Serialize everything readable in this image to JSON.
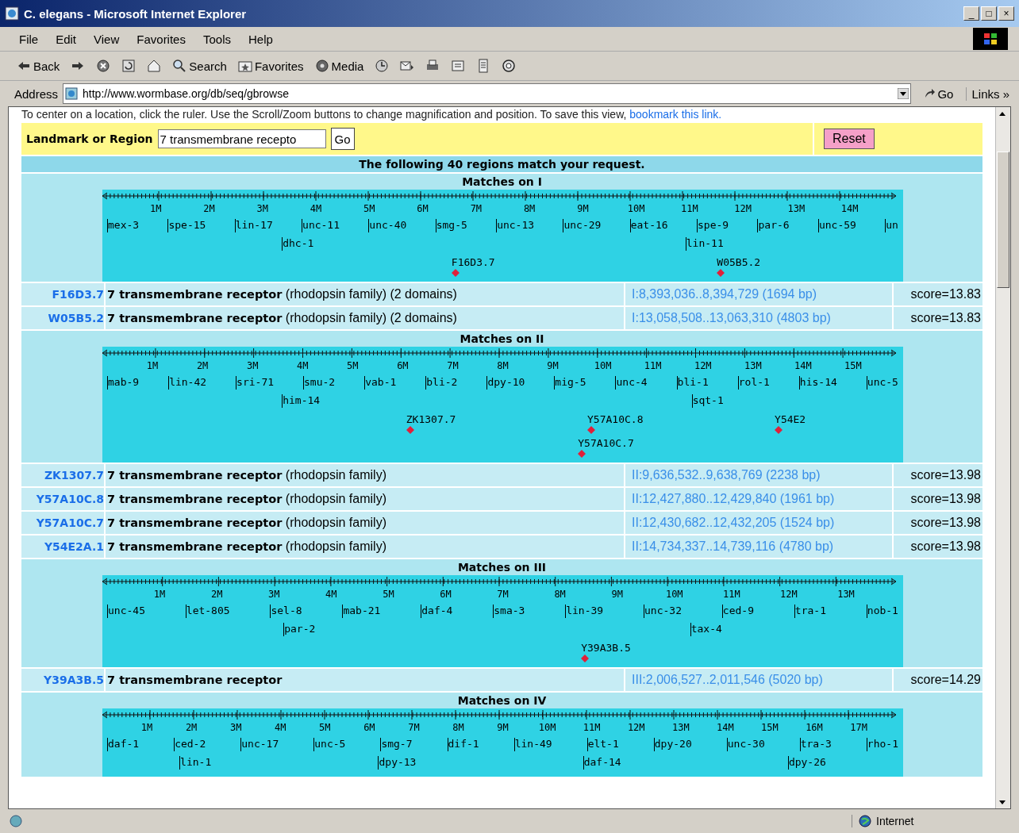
{
  "window": {
    "title": "C. elegans - Microsoft Internet Explorer",
    "controls": [
      "_",
      "□",
      "×"
    ]
  },
  "menu": [
    "File",
    "Edit",
    "View",
    "Favorites",
    "Tools",
    "Help"
  ],
  "toolbar": [
    {
      "kind": "back",
      "label": "Back"
    },
    {
      "kind": "forward"
    },
    {
      "kind": "stop"
    },
    {
      "kind": "refresh"
    },
    {
      "kind": "home"
    },
    {
      "kind": "search",
      "label": "Search"
    },
    {
      "kind": "favorites",
      "label": "Favorites"
    },
    {
      "kind": "media",
      "label": "Media"
    },
    {
      "kind": "history"
    },
    {
      "kind": "mail"
    },
    {
      "kind": "print"
    },
    {
      "kind": "edit"
    },
    {
      "kind": "discuss"
    },
    {
      "kind": "messenger"
    }
  ],
  "address": {
    "label": "Address",
    "value": "http://www.wormbase.org/db/seq/gbrowse",
    "go": "Go",
    "links": "Links »"
  },
  "page": {
    "instructions": "To center on a location, click the ruler. Use the Scroll/Zoom buttons to change magnification and position. To save this view,",
    "bookmark_link": "bookmark this link.",
    "landmark": {
      "label": "Landmark or Region",
      "value": "7 transmembrane recepto",
      "go": "Go",
      "reset": "Reset"
    },
    "banner": "The following 40 regions match your request.",
    "sections": [
      {
        "title": "Matches on I",
        "ticks": [
          "1M",
          "2M",
          "3M",
          "4M",
          "5M",
          "6M",
          "7M",
          "8M",
          "9M",
          "10M",
          "11M",
          "12M",
          "13M",
          "14M"
        ],
        "gene_rows": [
          [
            "mex-3",
            "spe-15",
            "lin-17",
            "unc-11",
            "unc-40",
            "smg-5",
            "unc-13",
            "unc-29",
            "eat-16",
            "spe-9",
            "par-6",
            "unc-59",
            "un"
          ],
          [
            "dhc-1",
            "lin-11"
          ]
        ],
        "hit_rows": [
          [
            "F16D3.7",
            "W05B5.2"
          ]
        ],
        "matches": [
          {
            "id": "F16D3.7",
            "description": "**7 transmembrane receptor** (rhodopsin family) (2 domains)",
            "location": "I:8,393,036..8,394,729 (1694 bp)",
            "score": "score=13.83"
          },
          {
            "id": "W05B5.2",
            "description": "**7 transmembrane receptor** (rhodopsin family) (2 domains)",
            "location": "I:13,058,508..13,063,310 (4803 bp)",
            "score": "score=13.83"
          }
        ]
      },
      {
        "title": "Matches on II",
        "ticks": [
          "1M",
          "2M",
          "3M",
          "4M",
          "5M",
          "6M",
          "7M",
          "8M",
          "9M",
          "10M",
          "11M",
          "12M",
          "13M",
          "14M",
          "15M"
        ],
        "gene_rows": [
          [
            "mab-9",
            "lin-42",
            "sri-71",
            "smu-2",
            "vab-1",
            "bli-2",
            "dpy-10",
            "mig-5",
            "unc-4",
            "bli-1",
            "rol-1",
            "his-14",
            "unc-5"
          ],
          [
            "him-14",
            "sqt-1"
          ]
        ],
        "hit_rows": [
          [
            "ZK1307.7",
            "Y57A10C.8",
            "Y54E2"
          ],
          [
            "Y57A10C.7"
          ]
        ],
        "matches": [
          {
            "id": "ZK1307.7",
            "description": "**7 transmembrane receptor** (rhodopsin family)",
            "location": "II:9,636,532..9,638,769 (2238 bp)",
            "score": "score=13.98"
          },
          {
            "id": "Y57A10C.8",
            "description": "**7 transmembrane receptor** (rhodopsin family)",
            "location": "II:12,427,880..12,429,840 (1961 bp)",
            "score": "score=13.98"
          },
          {
            "id": "Y57A10C.7",
            "description": "**7 transmembrane receptor** (rhodopsin family)",
            "location": "II:12,430,682..12,432,205 (1524 bp)",
            "score": "score=13.98"
          },
          {
            "id": "Y54E2A.1",
            "description": "**7 transmembrane receptor** (rhodopsin family)",
            "location": "II:14,734,337..14,739,116 (4780 bp)",
            "score": "score=13.98"
          }
        ]
      },
      {
        "title": "Matches on III",
        "ticks": [
          "1M",
          "2M",
          "3M",
          "4M",
          "5M",
          "6M",
          "7M",
          "8M",
          "9M",
          "10M",
          "11M",
          "12M",
          "13M"
        ],
        "gene_rows": [
          [
            "unc-45",
            "let-805",
            "sel-8",
            "mab-21",
            "daf-4",
            "sma-3",
            "lin-39",
            "unc-32",
            "ced-9",
            "tra-1",
            "nob-1"
          ],
          [
            "par-2",
            "tax-4"
          ]
        ],
        "hit_rows": [
          [
            "Y39A3B.5"
          ]
        ],
        "matches": [
          {
            "id": "Y39A3B.5",
            "description": "**7 transmembrane receptor**",
            "location": "III:2,006,527..2,011,546 (5020 bp)",
            "score": "score=14.29"
          }
        ]
      },
      {
        "title": "Matches on IV",
        "ticks": [
          "1M",
          "2M",
          "3M",
          "4M",
          "5M",
          "6M",
          "7M",
          "8M",
          "9M",
          "10M",
          "11M",
          "12M",
          "13M",
          "14M",
          "15M",
          "16M",
          "17M"
        ],
        "gene_rows": [
          [
            "daf-1",
            "ced-2",
            "unc-17",
            "unc-5",
            "smg-7",
            "dif-1",
            "lin-49",
            "elt-1",
            "dpy-20",
            "unc-30",
            "tra-3",
            "rho-1"
          ],
          [
            "lin-1",
            "dpy-13",
            "daf-14",
            "dpy-26"
          ]
        ]
      }
    ]
  },
  "status_bar": {
    "zone": "Internet"
  }
}
